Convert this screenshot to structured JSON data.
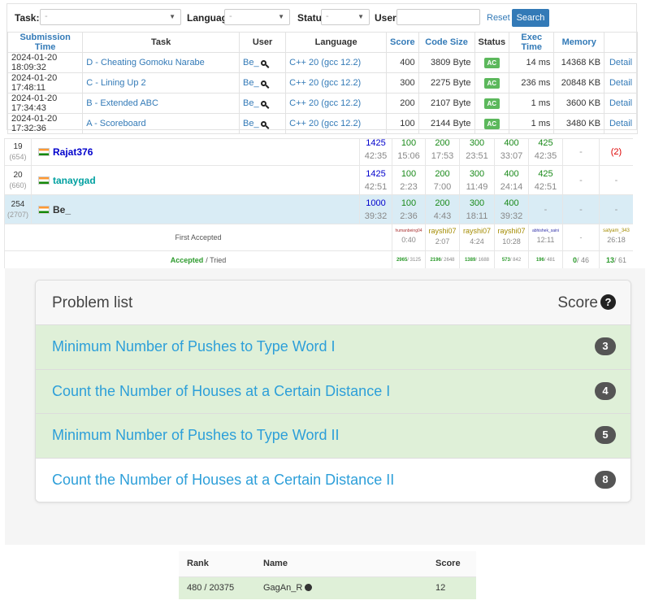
{
  "submissions": {
    "filters": {
      "task_label": "Task:",
      "task_value": "-",
      "language_label": "Language:",
      "language_value": "-",
      "status_label": "Status:",
      "status_value": "-",
      "user_label": "User:",
      "user_value": "",
      "reset_label": "Reset",
      "search_label": "Search"
    },
    "columns": [
      "Submission Time",
      "Task",
      "User",
      "Language",
      "Score",
      "Code Size",
      "Status",
      "Exec Time",
      "Memory",
      ""
    ],
    "rows": [
      {
        "time": "2024-01-20 18:09:32",
        "task": "D - Cheating Gomoku Narabe",
        "user": "Be_",
        "language": "C++ 20 (gcc 12.2)",
        "score": "400",
        "code_size": "3809 Byte",
        "status": "AC",
        "exec_time": "14 ms",
        "memory": "14368 KB",
        "detail": "Detail"
      },
      {
        "time": "2024-01-20 17:48:11",
        "task": "C - Lining Up 2",
        "user": "Be_",
        "language": "C++ 20 (gcc 12.2)",
        "score": "300",
        "code_size": "2275 Byte",
        "status": "AC",
        "exec_time": "236 ms",
        "memory": "20848 KB",
        "detail": "Detail"
      },
      {
        "time": "2024-01-20 17:34:43",
        "task": "B - Extended ABC",
        "user": "Be_",
        "language": "C++ 20 (gcc 12.2)",
        "score": "200",
        "code_size": "2107 Byte",
        "status": "AC",
        "exec_time": "1 ms",
        "memory": "3600 KB",
        "detail": "Detail"
      },
      {
        "time": "2024-01-20 17:32:36",
        "task": "A - Scoreboard",
        "user": "Be_",
        "language": "C++ 20 (gcc 12.2)",
        "score": "100",
        "code_size": "2144 Byte",
        "status": "AC",
        "exec_time": "1 ms",
        "memory": "3480 KB",
        "detail": "Detail"
      }
    ]
  },
  "standings": {
    "rows": [
      {
        "rank": "19",
        "rank_sub": "(654)",
        "user": "Rajat376",
        "user_color": "#0000cc",
        "total": "1425",
        "total_time": "42:35",
        "cells": [
          [
            "100",
            "15:06"
          ],
          [
            "200",
            "17:53"
          ],
          [
            "300",
            "23:51"
          ],
          [
            "400",
            "33:07"
          ],
          [
            "425",
            "42:35"
          ],
          [
            "-",
            ""
          ],
          [
            "(2)",
            ""
          ]
        ]
      },
      {
        "rank": "20",
        "rank_sub": "(660)",
        "user": "tanaygad",
        "user_color": "#00a0a0",
        "total": "1425",
        "total_time": "42:51",
        "cells": [
          [
            "100",
            "2:23"
          ],
          [
            "200",
            "7:00"
          ],
          [
            "300",
            "11:49"
          ],
          [
            "400",
            "24:14"
          ],
          [
            "425",
            "42:51"
          ],
          [
            "-",
            ""
          ],
          [
            "-",
            ""
          ]
        ]
      },
      {
        "rank": "254",
        "rank_sub": "(2707)",
        "user": "Be_",
        "user_color": "#333333",
        "total": "1000",
        "total_time": "39:32",
        "cells": [
          [
            "100",
            "2:36"
          ],
          [
            "200",
            "4:43"
          ],
          [
            "300",
            "18:11"
          ],
          [
            "400",
            "39:32"
          ],
          [
            "-",
            ""
          ],
          [
            "-",
            ""
          ],
          [
            "-",
            ""
          ]
        ]
      }
    ],
    "first_accepted_label": "First Accepted",
    "first_accepted": [
      {
        "user": "humanbeing04",
        "time": "0:40"
      },
      {
        "user": "rayshi07",
        "time": "2:07"
      },
      {
        "user": "rayshi07",
        "time": "4:24"
      },
      {
        "user": "rayshi07",
        "time": "10:28"
      },
      {
        "user": "abhishek_saini",
        "time": "12:11"
      },
      {
        "user": "-",
        "time": ""
      },
      {
        "user": "satyam_343",
        "time": "26:18"
      }
    ],
    "accepted_label": "Accepted",
    "tried_label": "/ Tried",
    "accepted_tried": [
      {
        "ac": "2965",
        "tried": "/ 3125"
      },
      {
        "ac": "2196",
        "tried": "/ 2648"
      },
      {
        "ac": "1389",
        "tried": "/ 1688"
      },
      {
        "ac": "573",
        "tried": "/ 842"
      },
      {
        "ac": "196",
        "tried": "/ 481"
      },
      {
        "ac": "0",
        "tried": "/ 46"
      },
      {
        "ac": "13",
        "tried": "/ 61"
      }
    ]
  },
  "problem_list": {
    "title": "Problem list",
    "score_label": "Score",
    "help_icon": "?",
    "items": [
      {
        "name": "Minimum Number of Pushes to Type Word I",
        "score": "3",
        "solved": true
      },
      {
        "name": "Count the Number of Houses at a Certain Distance I",
        "score": "4",
        "solved": true
      },
      {
        "name": "Minimum Number of Pushes to Type Word II",
        "score": "5",
        "solved": true
      },
      {
        "name": "Count the Number of Houses at a Certain Distance II",
        "score": "8",
        "solved": false
      }
    ]
  },
  "rank_table": {
    "columns": [
      "Rank",
      "Name",
      "Score"
    ],
    "row": {
      "rank": "480 / 20375",
      "name": "GagAn_R",
      "score": "12"
    }
  }
}
